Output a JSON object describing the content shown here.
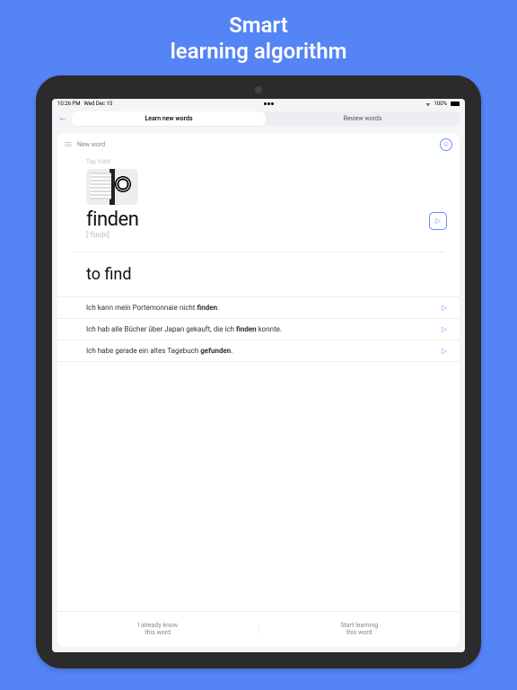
{
  "promo": {
    "line1": "Smart",
    "line2": "learning algorithm"
  },
  "status": {
    "time": "10:26 PM",
    "date": "Wed Dec 15",
    "battery": "100%"
  },
  "tabs": {
    "learn": "Learn new words",
    "review": "Review words",
    "active": "learn"
  },
  "card": {
    "badge": "New word",
    "deck": "Top 1000",
    "word": "finden",
    "ipa": "[ˈfɪndn]",
    "translation": "to find",
    "examples": [
      {
        "pre": "Ich kann mein Portemonnaie nicht ",
        "bold": "finden",
        "post": "."
      },
      {
        "pre": "Ich hab alle Bücher über Japan gekauft, die ich ",
        "bold": "finden",
        "post": " konnte."
      },
      {
        "pre": "Ich habe gerade ein altes Tagebuch ",
        "bold": "gefunden",
        "post": "."
      }
    ],
    "actions": {
      "know": "I already know\nthis word",
      "learn": "Start learning\nthis word"
    }
  }
}
